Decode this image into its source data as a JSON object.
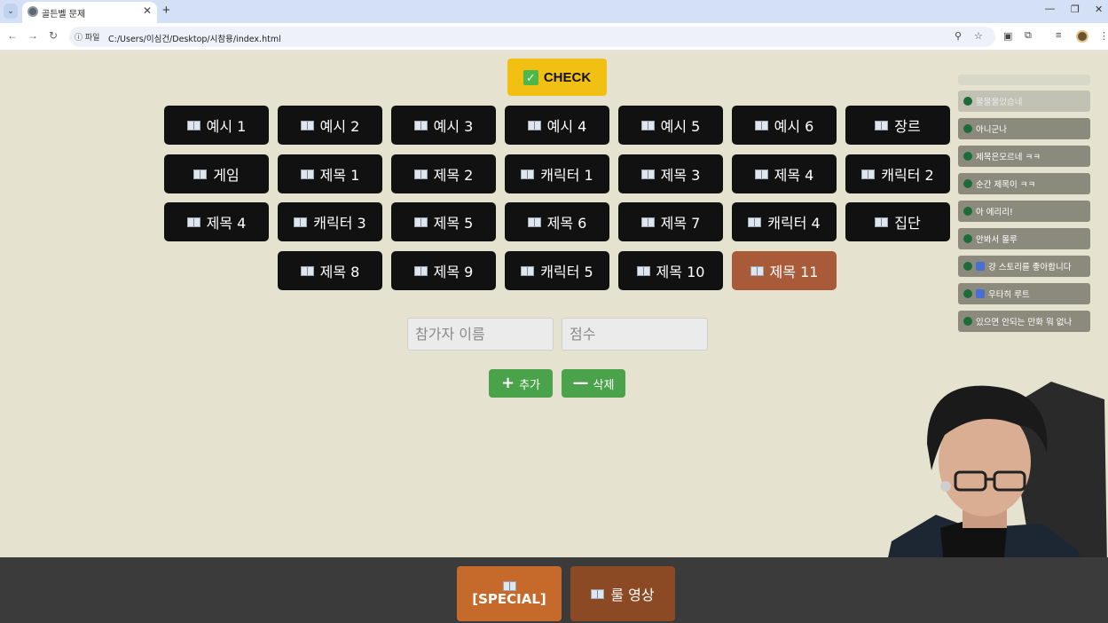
{
  "browser": {
    "tab_title": "골든벨 문제",
    "site_info_label": "파일",
    "url": "C:/Users/이심건/Desktop/시참용/index.html",
    "new_tab_symbol": "+",
    "close_symbol": "✕"
  },
  "check": {
    "label": "CHECK"
  },
  "grid": {
    "rows": [
      [
        "예시 1",
        "예시 2",
        "예시 3",
        "예시 4",
        "예시 5",
        "예시 6",
        "장르"
      ],
      [
        "게임",
        "제목 1",
        "제목 2",
        "캐릭터 1",
        "제목 3",
        "제목 4",
        "캐릭터 2"
      ],
      [
        "제목 4",
        "캐릭터 3",
        "제목 5",
        "제목 6",
        "제목 7",
        "캐릭터 4",
        "집단"
      ],
      [
        "제목 8",
        "제목 9",
        "캐릭터 5",
        "제목 10",
        "제목 11"
      ]
    ],
    "active_label": "제목 11"
  },
  "form": {
    "name_placeholder": "참가자 이름",
    "score_placeholder": "점수",
    "add_label": "추가",
    "delete_label": "삭제"
  },
  "chat": {
    "messages": [
      "물물물었습네",
      "아니군나",
      "제목은모르네 ㅋㅋ",
      "순간 제목이 ㅋㅋ",
      "아 에리리!",
      "안봐서 몰루",
      "걍 스토리를 좋아합니다",
      "우타히 루트",
      "있으면 안되는 만화 뭐 없나"
    ]
  },
  "footer": {
    "special_label": "[SPECIAL]",
    "rule_video_label": "룰 영상"
  },
  "colors": {
    "page_bg": "#e5e3cf",
    "button_dark": "#111111",
    "button_active": "#a95a38",
    "check_yellow": "#f2c013",
    "green": "#4aa34a",
    "special_orange": "#c66a2c",
    "rule_brown": "#8b4a24",
    "footer_bg": "#3b3b3b"
  }
}
